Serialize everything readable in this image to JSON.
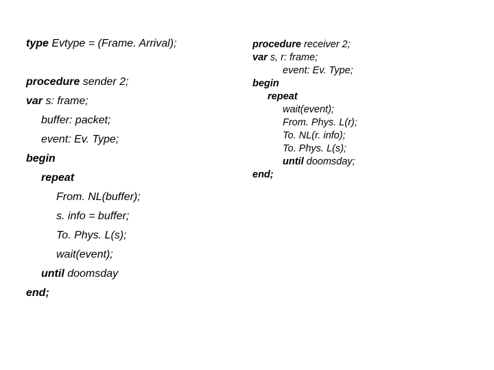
{
  "left": {
    "l1a": "type",
    "l1b": " Evtype = (Frame. Arrival);",
    "l2a": "procedure",
    "l2b": " sender 2;",
    "l3a": "var",
    "l3b": " s: frame;",
    "l4": "buffer: packet;",
    "l5": "event: Ev. Type;",
    "l6": "begin",
    "l7": "repeat",
    "l8": "From. NL(buffer);",
    "l9": "s. info = buffer;",
    "l10": "To. Phys. L(s);",
    "l11": "wait(event);",
    "l12a": "until",
    "l12b": " doomsday",
    "l13": "end;"
  },
  "right": {
    "r1a": "procedure",
    "r1b": " receiver 2;",
    "r2a": "var",
    "r2b": " s, r: frame;",
    "r3": "event: Ev. Type;",
    "r4": "begin",
    "r5": "repeat",
    "r6": "wait(event);",
    "r7": "From. Phys. L(r);",
    "r8": "To. NL(r. info);",
    "r9": "To. Phys. L(s);",
    "r10a": "until",
    "r10b": " doomsday;",
    "r11": "end;"
  }
}
